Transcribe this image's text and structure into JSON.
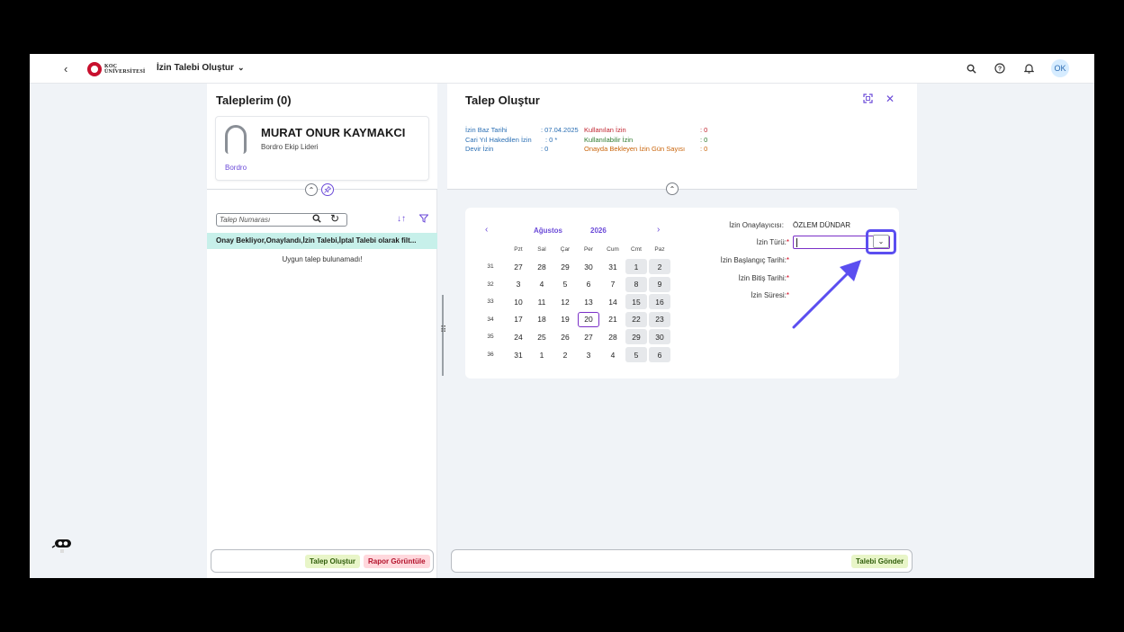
{
  "header": {
    "back_icon": "chevron-left-icon",
    "logo_line1": "KOÇ",
    "logo_line2": "ÜNİVERSİTESİ",
    "app_title": "İzin Talebi Oluştur",
    "avatar_initials": "OK"
  },
  "left": {
    "title": "Taleplerim (0)",
    "profile": {
      "name": "MURAT ONUR KAYMAKCI",
      "role": "Bordro Ekip Lideri",
      "link": "Bordro"
    },
    "search_placeholder": "Talep Numarası",
    "filter_text": "Onay Bekliyor,Onaylandı,İzin Talebi,İptal Talebi olarak filt...",
    "empty_message": "Uygun talep bulunamadı!",
    "footer": {
      "create_label": "Talep Oluştur",
      "report_label": "Rapor Görüntüle"
    }
  },
  "right": {
    "title": "Talep Oluştur",
    "info": {
      "base_date_label": "İzin Baz Tarihi",
      "base_date_value": ": 07.04.2025",
      "earned_label": "Cari Yıl Hakedilen İzin",
      "earned_value": ": 0 *",
      "carry_label": "Devir İzin",
      "carry_value": ": 0",
      "used_label": "Kullanılan İzin",
      "used_value": ": 0",
      "available_label": "Kullanılabilir İzin",
      "available_value": ": 0",
      "pending_label": "Onayda Bekleyen İzin Gün Sayısı",
      "pending_value": ": 0"
    },
    "calendar": {
      "month": "Ağustos",
      "year": "2026",
      "weekdays": [
        "Pzt",
        "Sal",
        "Çar",
        "Per",
        "Cum",
        "Cmt",
        "Paz"
      ],
      "weeks": [
        {
          "wk": "31",
          "days": [
            "27",
            "28",
            "29",
            "30",
            "31",
            "1",
            "2"
          ]
        },
        {
          "wk": "32",
          "days": [
            "3",
            "4",
            "5",
            "6",
            "7",
            "8",
            "9"
          ]
        },
        {
          "wk": "33",
          "days": [
            "10",
            "11",
            "12",
            "13",
            "14",
            "15",
            "16"
          ]
        },
        {
          "wk": "34",
          "days": [
            "17",
            "18",
            "19",
            "20",
            "21",
            "22",
            "23"
          ]
        },
        {
          "wk": "35",
          "days": [
            "24",
            "25",
            "26",
            "27",
            "28",
            "29",
            "30"
          ]
        },
        {
          "wk": "36",
          "days": [
            "31",
            "1",
            "2",
            "3",
            "4",
            "5",
            "6"
          ]
        }
      ],
      "today": "20"
    },
    "form": {
      "approver_label": "İzin Onaylayıcısı:",
      "approver_value": "ÖZLEM DÜNDAR",
      "type_label": "İzin Türü:",
      "start_label": "İzin Başlangıç Tarihi:",
      "end_label": "İzin Bitiş Tarihi:",
      "duration_label": "İzin Süresi:",
      "required_mark": "*"
    },
    "footer": {
      "submit_label": "Talebi Gönder"
    }
  },
  "colors": {
    "accent": "#6b4ad8",
    "annotation": "#5b4ef0",
    "filter_bar": "#c7f0ea"
  }
}
